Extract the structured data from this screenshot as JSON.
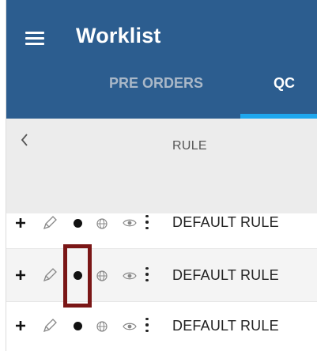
{
  "header": {
    "title": "Worklist",
    "tabs": [
      {
        "label": "PRE ORDERS",
        "active": false
      },
      {
        "label": "QC",
        "active": true
      }
    ]
  },
  "colors": {
    "appbar": "#2c5d8f",
    "tab_indicator": "#1ea7ee",
    "highlight": "#7a1616",
    "header_band": "#ececec"
  },
  "rule_header": {
    "label": "RULE",
    "back_icon": "chevron-left-icon"
  },
  "rows": [
    {
      "label": "DEFAULT RULE"
    },
    {
      "label": "DEFAULT RULE"
    },
    {
      "label": "DEFAULT RULE"
    }
  ],
  "row_icons": [
    "plus-icon",
    "pencil-icon",
    "status-dot-icon",
    "globe-icon",
    "eye-icon",
    "kebab-menu-icon"
  ]
}
